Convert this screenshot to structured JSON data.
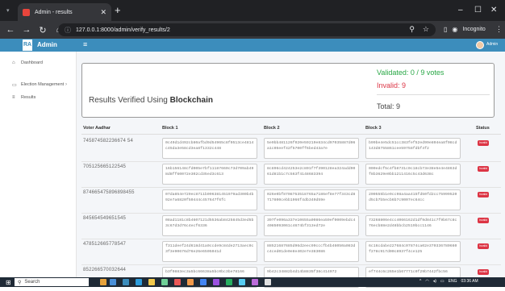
{
  "browser": {
    "tab_title": "Admin - results",
    "tab_close": "✕",
    "new_tab": "+",
    "url": "127.0.0.1:8000/admin/verify_results/2",
    "profile_label": "Incognito",
    "win_min": "–",
    "win_max": "☐",
    "win_close": "✕"
  },
  "sidebar": {
    "brand_logo": "RA",
    "brand_title": "Admin",
    "items": [
      {
        "label": "Dashboard",
        "icon": "dashboard-icon",
        "glyph": "⌂"
      },
      {
        "label": "Election Management",
        "icon": "calendar-icon",
        "glyph": "▭",
        "chevron": "›"
      },
      {
        "label": "Results",
        "icon": "list-icon",
        "glyph": "≡"
      }
    ]
  },
  "topnav": {
    "menu_glyph": "≡",
    "user_name": "Admin"
  },
  "summary": {
    "title_prefix": "Results Verified Using ",
    "title_bold": "Blockchain",
    "validated": "Validated: 0 / 9 votes",
    "invalid": "Invalid: 9",
    "total": "Total: 9"
  },
  "table": {
    "headers": [
      "Voter Aadhar",
      "Block 1",
      "Block 2",
      "Block 3",
      "Status"
    ],
    "rows": [
      {
        "aadhar": "745874582236674 54",
        "block1": "0c49d1d492cb80afbd9d54965c8f0513ce4814c45da3e58cd3ea8f1332c448",
        "block2": "5e9bb481126f020e59219e834cd97035887d06a1c05eef42f5700ff6bed43a7e",
        "block3": "b99be4e5dc51cc383fef52ed99e804ea8f08cd143d8755861cee59758fdbf4f2",
        "status": "Invalid"
      },
      {
        "aadhar": "705125665122545",
        "block1": "16b156148cfd005e7bf11187660c73d709ab498d8ff60072e302cd35ed3c613",
        "block2": "8c896cd424253e2c801f7f390128ea324add9061d81b1c7c563f4148683394",
        "block3": "000edcf5c4fb8731c0c18cb73e38e5e4e4863df8b3629e0bb1211416c5c43d638c",
        "status": "Invalid"
      },
      {
        "aadhar": "874665475896898455",
        "block1": "07da854e729ec8711b096381451979ad300b4b92e7a6820f50444c457647f6fc",
        "block2": "026e0bf8708753518765a7186ef8e77f343cd8717800cebb1966f4db340d59e",
        "block3": "200555b1e9cc98a4aa415fd50fd2cc75999520d5cb7b5ecb6b7c9007ec64cc",
        "status": "Invalid"
      },
      {
        "aadhar": "845654549651545",
        "block1": "08ad1181c8b4607121d5536ab8425845d3ed5b3c67d3d76c4ecf6336",
        "block2": "397fe096a337e10655a0086ea59ef0009ebdc44085093061c4674bf313ed72e",
        "block3": "73268806e4cc4066162d1df9d841c7f9b67c8c76ecb88e2d48bbcb2519bcc1146",
        "status": "Invalid"
      },
      {
        "aadhar": "478512665778547",
        "block1": "f311deef24d618d41a0ccde9c84de2713aec0c3f3e90676d76e26e6505041d",
        "block2": "88521687685d96d2eec99cccfb4b46050a083dc4ced01de0e8e402e7e383086",
        "block3": "6c16cdabe227684c07874ca02e370336780660f278c917d00c8937f4ce125",
        "status": "Invalid"
      },
      {
        "aadhar": "852266570032644",
        "block1": "b3f0883ec3a5bc66638a5bc0bc3be78166",
        "block2": "9b42c34882b4d14b8835f38c414072",
        "block3": "ef744c6c265e1b67771c0f29b7442fbc56",
        "status": "Invalid"
      }
    ]
  },
  "taskbar": {
    "search_label": "Search",
    "lang": "ENG",
    "time": "03:36 AM"
  }
}
